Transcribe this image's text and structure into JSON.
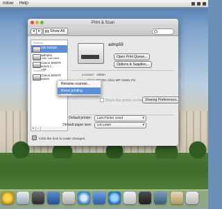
{
  "menubar": {
    "items": [
      "",
      "ndow",
      "Help"
    ]
  },
  "window": {
    "title": "Print & Scan",
    "show_all": "Show All"
  },
  "list": {
    "printers_header": "Printers",
    "scanners_header": "Scanners",
    "printers": [
      {
        "name": "Idle Default",
        "sub": "",
        "selected": true
      },
      {
        "name": "admp61",
        "sub": "• Idle, Last Used",
        "selected": false
      },
      {
        "name": "Canon MX870 series (...",
        "sub": "• Idle",
        "selected": false
      }
    ],
    "scanners": [
      {
        "name": "Canon MX870 series"
      }
    ],
    "add": "+",
    "remove": "−"
  },
  "detail": {
    "printer_name": "admp59",
    "open_queue": "Open Print Queue...",
    "options": "Options & Supplies...",
    "location_label": "Location:",
    "location_value": "Admin",
    "kind_label": "Kind:",
    "kind_value": "RICOH Aficio MP C5501 PS",
    "status_label": "Status:",
    "status_value": "Idle",
    "share_label": "Share this printer on the network",
    "sharing_prefs": "Sharing Preferences..."
  },
  "context_menu": {
    "items": [
      "Rename scanner...",
      "Reset printing system..."
    ],
    "highlighted": 1
  },
  "bottom": {
    "default_printer_label": "Default printer:",
    "default_printer_value": "Last Printer Used",
    "paper_size_label": "Default paper size:",
    "paper_size_value": "US Letter",
    "lock_text": "Click the lock to make changes."
  }
}
